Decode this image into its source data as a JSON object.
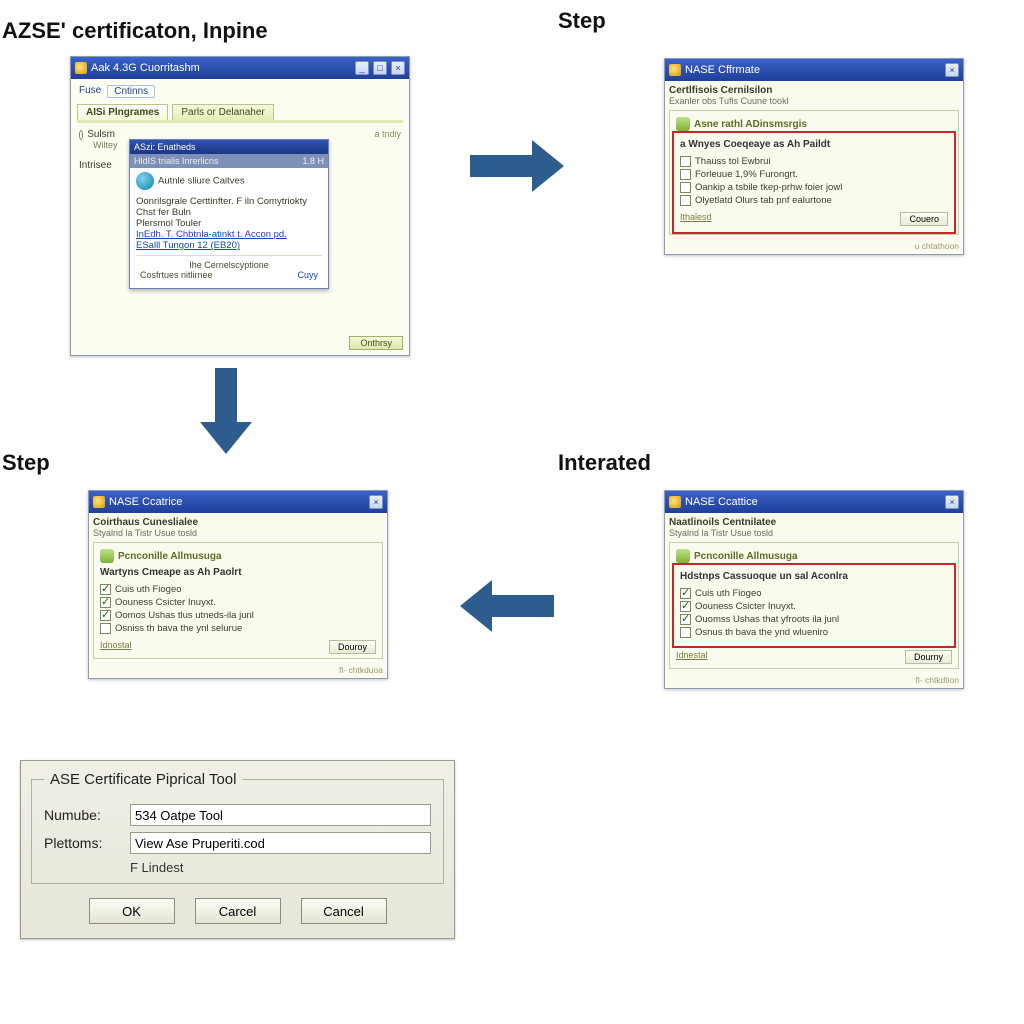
{
  "headings": {
    "top_left": "AZSE' certificaton, Inpine",
    "top_right": "Step",
    "mid_left": "Step",
    "mid_right": "Interated"
  },
  "arrows": {
    "right1": "arrow-right",
    "down1": "arrow-down",
    "left1": "arrow-left"
  },
  "win1": {
    "title": "Aak 4.3G Cuorritashm",
    "btn_min": "_",
    "btn_max": "□",
    "btn_close": "×",
    "toolbar": {
      "a": "Fuse",
      "b": "Cntinns"
    },
    "tabs": {
      "a": "AISi Plngrames",
      "b": "Parls or Delanaher"
    },
    "left": {
      "opt1": "Sulsm",
      "opt1_sub": "Wiltey",
      "opt2": "Intrisee"
    },
    "right_note": "a tndiy",
    "popup": {
      "h1": "ASzi: Enatheds",
      "h2": "HldIS trialis Inrerlicns",
      "h2_right": "1.8 H",
      "row1": "Autnle sliure Caitves",
      "p1": "Oonrilsgrale Certtinfter. F iln Comytriokty",
      "p2": "Chst fer Buln",
      "p3": "Plersmol Touler",
      "link1": "InEdh. T. Chbtnla-atinkt t. Accon pd.",
      "link2": "ESalll Tungon 12 (EB20)",
      "foot1": "Ihe Cernelscyptione",
      "foot2": "Cosfrtues nitlirnee",
      "foot_btn": "Cuyy"
    },
    "bottom_btn": "Onthrsy"
  },
  "win2": {
    "title": "NASE Cffrmate",
    "btn_close": "×",
    "subhead": "Certlfisois Cernilsilon",
    "subdesc": "Exanler obs Tufls Cuune tookl",
    "panel_h": "Asne rathl ADinsmsrgis",
    "legend": "a Wnyes Coeqeaye as Ah Paildt",
    "items": [
      {
        "checked": false,
        "label": "Thauss tol Ewbrui"
      },
      {
        "checked": false,
        "label": "Forleuue 1,9% Furongrt."
      },
      {
        "checked": false,
        "label": "Oankip a tsbile tkep-prhw foier jowl"
      },
      {
        "checked": false,
        "label": "Olyetlatd Olurs tab pnf ealurtone"
      }
    ],
    "foot_left": "Ithalesd",
    "foot_btn": "Couero",
    "footer": "u chtathoon"
  },
  "win3": {
    "title": "NASE Ccatrice",
    "btn_close": "×",
    "subhead": "Coirthaus Cuneslialee",
    "subdesc": "Styalnd la Tistr Usue tosld",
    "panel_h": "Pcnconille Allmusuga",
    "legend": "Wartyns Cmeape as Ah Paolrt",
    "items": [
      {
        "checked": true,
        "label": "Cuis uth Fiogeo"
      },
      {
        "checked": true,
        "label": "Oouness Csicter Inuyxt."
      },
      {
        "checked": true,
        "label": "Oomos Ushas tlus utneds-ila junl"
      },
      {
        "checked": false,
        "label": "Osniss th bava the ynl selurue"
      }
    ],
    "foot_left": "Idnostal",
    "foot_btn": "Douroy",
    "footer": "fl- chtkduoa"
  },
  "win4": {
    "title": "NASE Ccattice",
    "btn_close": "×",
    "subhead": "Naatlinoils Centnilatee",
    "subdesc": "Styalnd la Tistr Usue tosld",
    "panel_h": "Pcnconille Allmusuga",
    "legend": "Hdstnps Cassuoque un sal Aconlra",
    "items": [
      {
        "checked": true,
        "label": "Cuis uth Fiogeo"
      },
      {
        "checked": true,
        "label": "Oouness Csicter Inuyxt."
      },
      {
        "checked": true,
        "label": "Ouomss Ushas that yfroots ila junl"
      },
      {
        "checked": false,
        "label": "Osnus th bava the ynd wlueniro"
      }
    ],
    "foot_left": "Idnestal",
    "foot_btn": "Dourny",
    "footer": "fl- chtkdtion"
  },
  "dialog": {
    "legend": "ASE Certificate Piprical Tool",
    "field1": {
      "label": "Numube:",
      "value": "534 Oatpe Tool"
    },
    "field2": {
      "label": "Plettoms:",
      "value": "View Ase Pruperiti.cod"
    },
    "hint": "F Lindest",
    "buttons": {
      "ok": "OK",
      "carcel": "Carcel",
      "cancel": "Cancel"
    }
  }
}
